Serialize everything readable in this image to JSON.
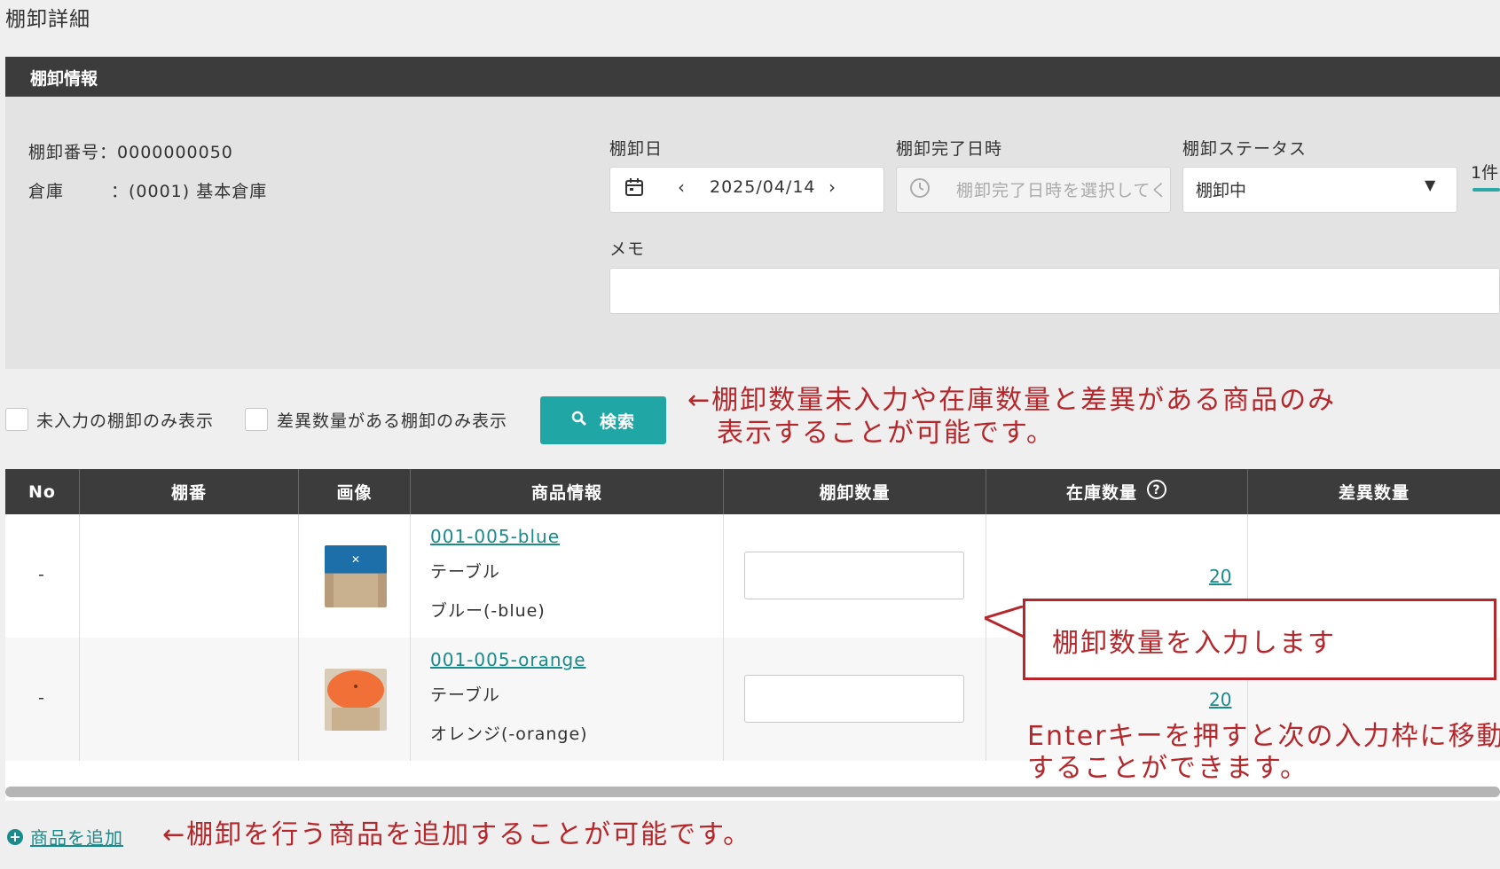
{
  "page": {
    "title": "棚卸詳細"
  },
  "panel": {
    "header": "棚卸情報",
    "inventory_number_label": "棚卸番号",
    "inventory_number_value": "：0000000050",
    "warehouse_label": "倉庫",
    "warehouse_value": "：(0001) 基本倉庫",
    "date_label": "棚卸日",
    "date_value": "2025/04/14",
    "completion_label": "棚卸完了日時",
    "completion_placeholder": "棚卸完了日時を選択してください",
    "status_label": "棚卸ステータス",
    "status_value": "棚卸中",
    "count_text": "1件",
    "memo_label": "メモ",
    "memo_value": ""
  },
  "filters": {
    "unentered_only": "未入力の棚卸のみ表示",
    "difference_only": "差異数量がある棚卸のみ表示",
    "search_button": "検索"
  },
  "table": {
    "columns": [
      "No",
      "棚番",
      "画像",
      "商品情報",
      "棚卸数量",
      "在庫数量",
      "差異数量"
    ],
    "rows": [
      {
        "no": "-",
        "location": "",
        "code": "001-005-blue",
        "name": "テーブル",
        "variant": "ブルー(-blue)",
        "qty": "",
        "stock": "20",
        "diff": "",
        "image_color": "#1c6fa8"
      },
      {
        "no": "-",
        "location": "",
        "code": "001-005-orange",
        "name": "テーブル",
        "variant": "オレンジ(-orange)",
        "qty": "",
        "stock": "20",
        "diff": "",
        "image_color": "#f07038"
      }
    ]
  },
  "add_item": "商品を追加",
  "annotations": {
    "filter_note_line1": "←棚卸数量未入力や在庫数量と差異がある商品のみ",
    "filter_note_line2": "表示することが可能です。",
    "callout": "棚卸数量を入力します",
    "enter_note_line1": "Enterキーを押すと次の入力枠に移動",
    "enter_note_line2": "することができます。",
    "add_note": "←棚卸を行う商品を追加することが可能です。"
  },
  "colors": {
    "accent": "#21a6a6",
    "header_bg": "#3c3c3c",
    "annotation": "#b5272b"
  }
}
